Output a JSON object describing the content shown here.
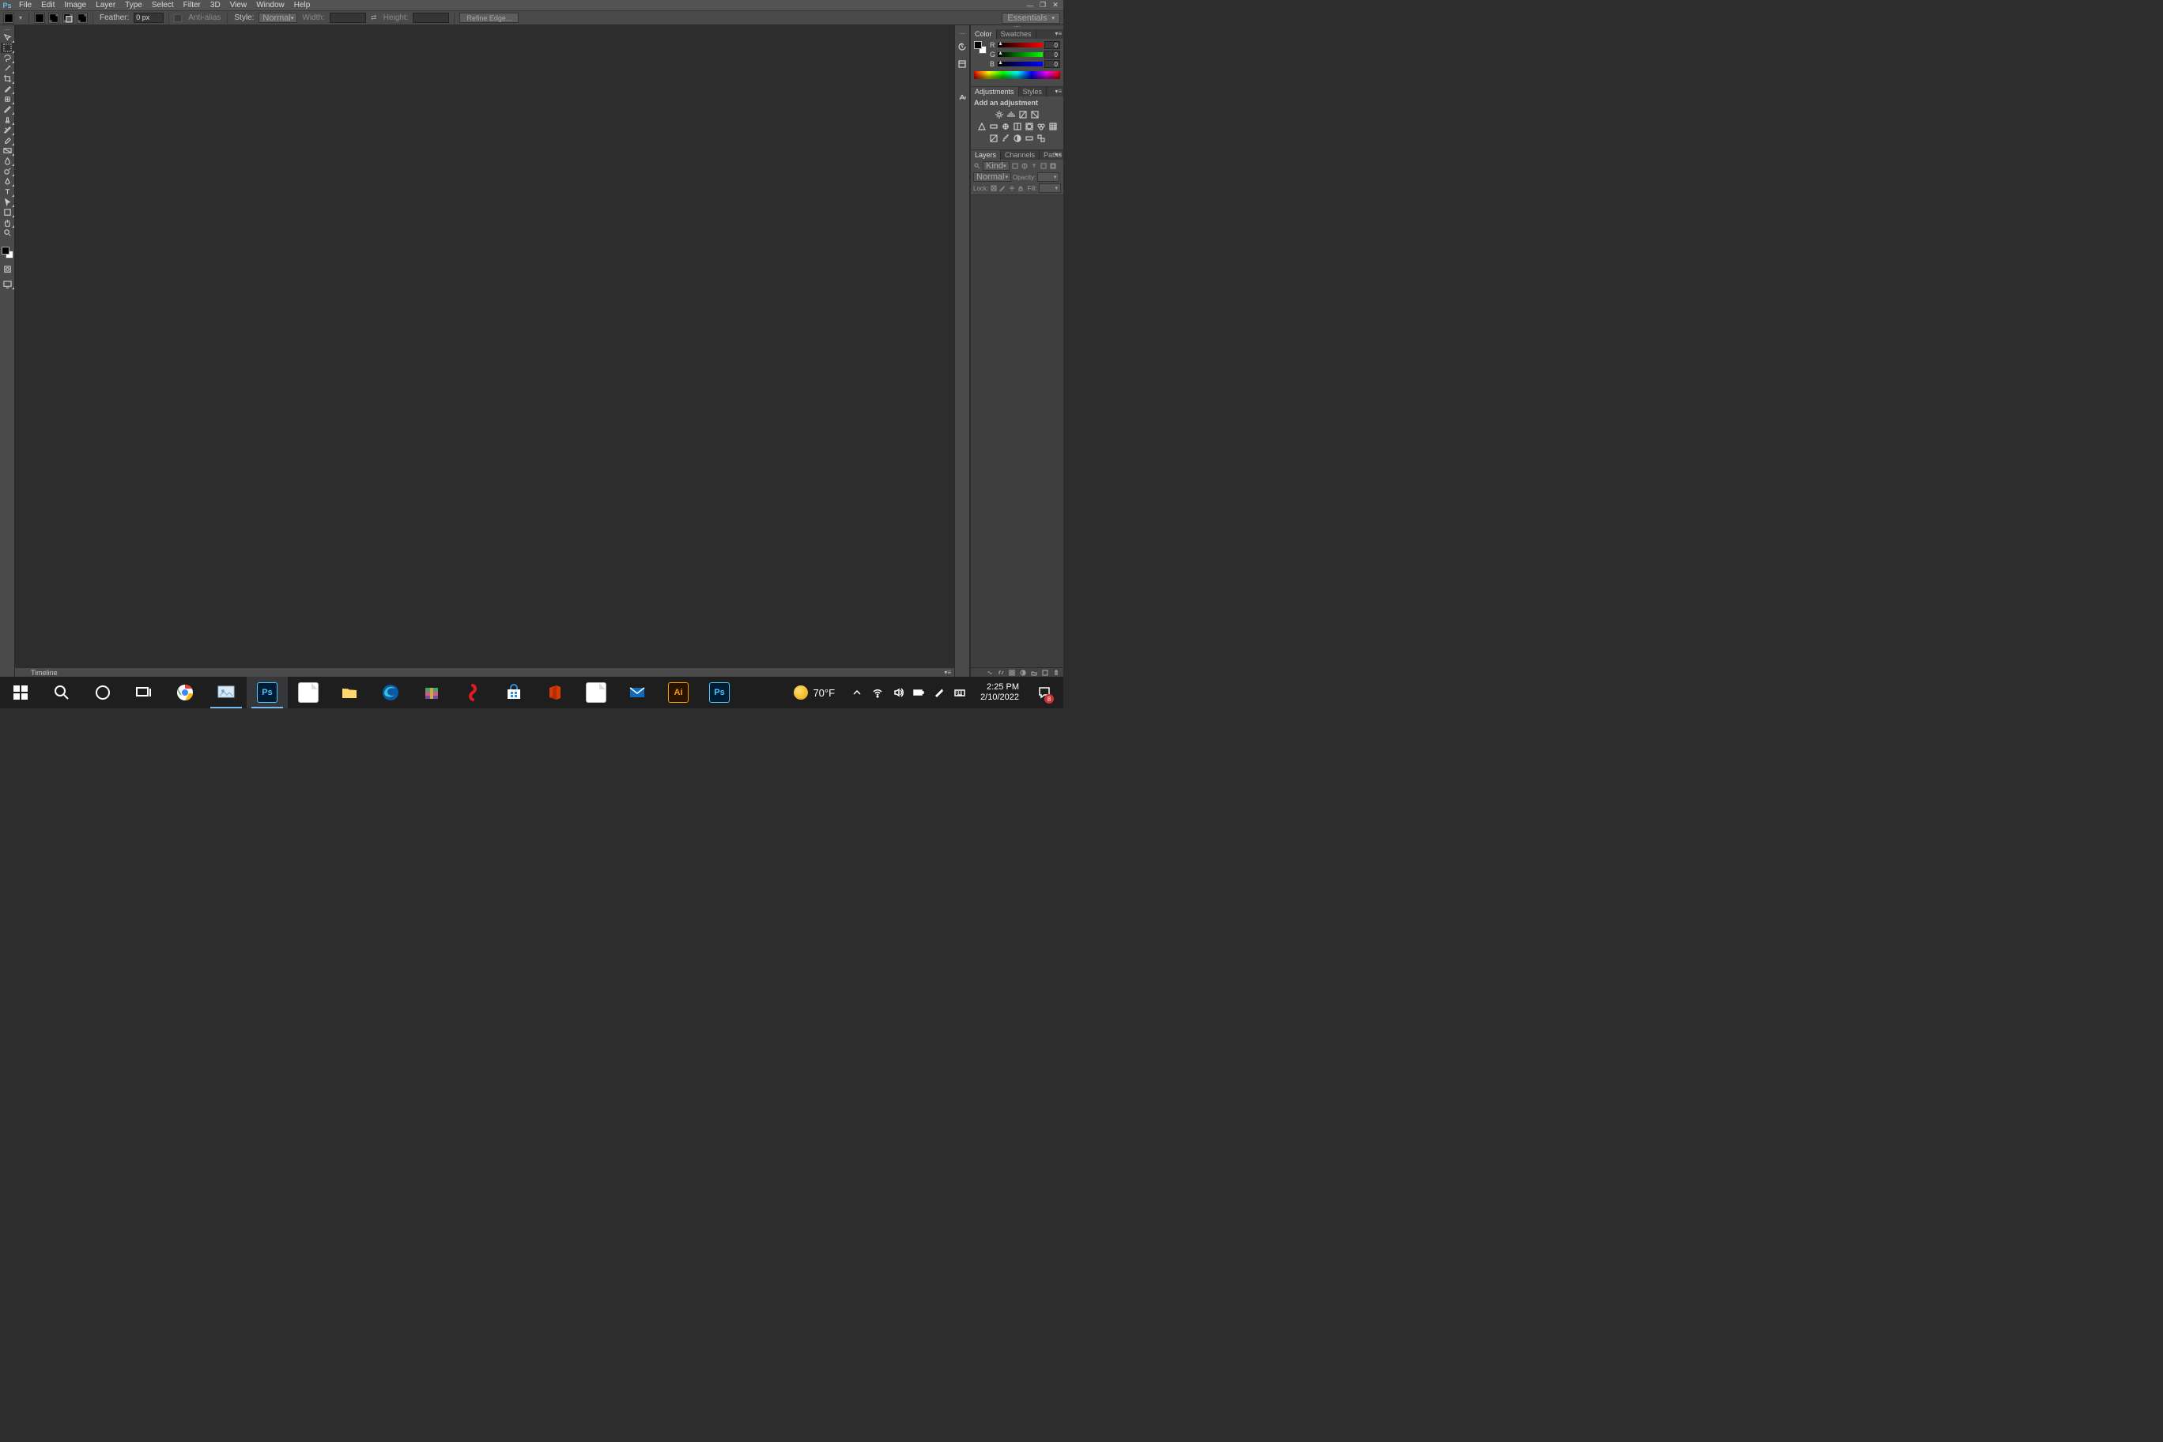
{
  "menubar": {
    "items": [
      "File",
      "Edit",
      "Image",
      "Layer",
      "Type",
      "Select",
      "Filter",
      "3D",
      "View",
      "Window",
      "Help"
    ]
  },
  "optionsbar": {
    "feather_label": "Feather:",
    "feather_value": "0 px",
    "antialias_label": "Anti-alias",
    "style_label": "Style:",
    "style_value": "Normal",
    "width_label": "Width:",
    "height_label": "Height:",
    "refine_label": "Refine Edge...",
    "workspace": "Essentials"
  },
  "panels": {
    "color": {
      "tabs": [
        "Color",
        "Swatches"
      ],
      "channels": [
        {
          "ch": "R",
          "val": "0"
        },
        {
          "ch": "G",
          "val": "0"
        },
        {
          "ch": "B",
          "val": "0"
        }
      ]
    },
    "adjustments": {
      "tabs": [
        "Adjustments",
        "Styles"
      ],
      "title": "Add an adjustment"
    },
    "layers": {
      "tabs": [
        "Layers",
        "Channels",
        "Paths"
      ],
      "kind_label": "Kind",
      "blend": "Normal",
      "opacity_label": "Opacity:",
      "lock_label": "Lock:",
      "fill_label": "Fill:"
    }
  },
  "timeline": {
    "label": "Timeline"
  },
  "taskbar": {
    "weather_temp": "70°F",
    "time": "2:25 PM",
    "date": "2/10/2022",
    "notif_count": "8"
  }
}
